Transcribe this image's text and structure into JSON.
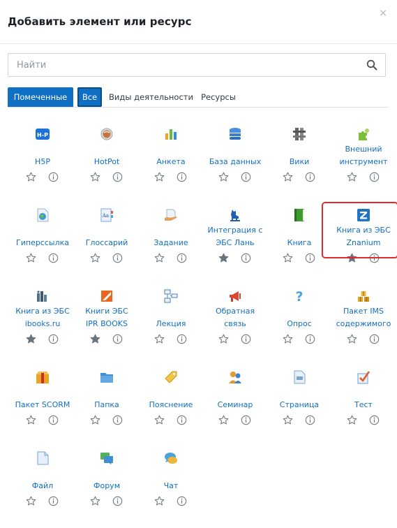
{
  "modal": {
    "title": "Добавить элемент или ресурс",
    "close": "×"
  },
  "search": {
    "placeholder": "Найти"
  },
  "tabs": [
    {
      "label": "Помеченные"
    },
    {
      "label": "Все"
    },
    {
      "label": "Виды деятельности"
    },
    {
      "label": "Ресурсы"
    }
  ],
  "items": [
    {
      "line1": "",
      "line2": "H5P",
      "icon": "h5p-icon",
      "starred": false
    },
    {
      "line1": "",
      "line2": "HotPot",
      "icon": "hotpot-icon",
      "starred": false
    },
    {
      "line1": "",
      "line2": "Анкета",
      "icon": "bar-chart-icon",
      "starred": false
    },
    {
      "line1": "",
      "line2": "База данных",
      "icon": "database-icon",
      "starred": false
    },
    {
      "line1": "",
      "line2": "Вики",
      "icon": "wiki-icon",
      "starred": false
    },
    {
      "line1": "Внешний",
      "line2": "инструмент",
      "icon": "puzzle-icon",
      "starred": false
    },
    {
      "line1": "",
      "line2": "Гиперссылка",
      "icon": "url-globe-icon",
      "starred": false
    },
    {
      "line1": "",
      "line2": "Глоссарий",
      "icon": "glossary-icon",
      "starred": false
    },
    {
      "line1": "",
      "line2": "Задание",
      "icon": "assignment-hand-icon",
      "starred": false
    },
    {
      "line1": "Интеграция с",
      "line2": "ЭБС Лань",
      "icon": "lan-doe-icon",
      "starred": true
    },
    {
      "line1": "",
      "line2": "Книга",
      "icon": "book-icon",
      "starred": false
    },
    {
      "line1": "Книга из ЭБС",
      "line2": "Znanium",
      "icon": "znanium-z-icon",
      "starred": true
    },
    {
      "line1": "Книга из ЭБС",
      "line2": "ibooks.ru",
      "icon": "ibooks-icon",
      "starred": true
    },
    {
      "line1": "Книги ЭБС",
      "line2": "IPR BOOKS",
      "icon": "iprbooks-icon",
      "starred": true
    },
    {
      "line1": "",
      "line2": "Лекция",
      "icon": "lesson-icon",
      "starred": false
    },
    {
      "line1": "Обратная",
      "line2": "связь",
      "icon": "megaphone-icon",
      "starred": false
    },
    {
      "line1": "",
      "line2": "Опрос",
      "icon": "question-mark-icon",
      "starred": false
    },
    {
      "line1": "Пакет IMS",
      "line2": "содержимого",
      "icon": "ims-boxes-icon",
      "starred": false
    },
    {
      "line1": "",
      "line2": "Пакет SCORM",
      "icon": "scorm-box-icon",
      "starred": false
    },
    {
      "line1": "",
      "line2": "Папка",
      "icon": "folder-icon",
      "starred": false
    },
    {
      "line1": "",
      "line2": "Пояснение",
      "icon": "label-tag-icon",
      "starred": false
    },
    {
      "line1": "",
      "line2": "Семинар",
      "icon": "workshop-people-icon",
      "starred": false
    },
    {
      "line1": "",
      "line2": "Страница",
      "icon": "page-icon",
      "starred": false
    },
    {
      "line1": "",
      "line2": "Тест",
      "icon": "quiz-check-icon",
      "starred": false
    },
    {
      "line1": "",
      "line2": "Файл",
      "icon": "file-icon",
      "starred": false
    },
    {
      "line1": "",
      "line2": "Форум",
      "icon": "forum-icon",
      "starred": false
    },
    {
      "line1": "",
      "line2": "Чат",
      "icon": "chat-icon",
      "starred": false
    }
  ],
  "colors": {
    "accent": "#0f6fc5",
    "highlight": "#e02b2b",
    "star_filled": "#6a737b",
    "icon_gray": "#8f959e"
  }
}
